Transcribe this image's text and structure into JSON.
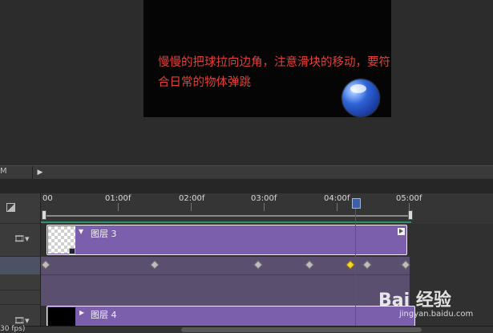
{
  "preview": {
    "caption": "慢慢的把球拉向边角，注意滑块的移动，要符合日常的物体弹跳"
  },
  "controls": {
    "left_label": "M",
    "play_icon": "play-icon"
  },
  "ruler": {
    "labels": [
      "00",
      "01:00f",
      "02:00f",
      "03:00f",
      "04:00f",
      "05:00f"
    ]
  },
  "layers": [
    {
      "name": "图层 3",
      "expanded": true,
      "thumbnail": "transparent"
    },
    {
      "name": "图层 4",
      "expanded": false,
      "thumbnail": "black"
    }
  ],
  "keyframes": {
    "count": 7,
    "selected_index": 4
  },
  "status": {
    "fps_text": "30 fps)"
  },
  "colors": {
    "clip": "#7b5fad",
    "playhead": "#e02020",
    "caption": "#e0403a",
    "keyframe_selected": "#f5d23a"
  },
  "watermark": {
    "brand": "Bai 经验",
    "url": "jingyan.baidu.com"
  }
}
